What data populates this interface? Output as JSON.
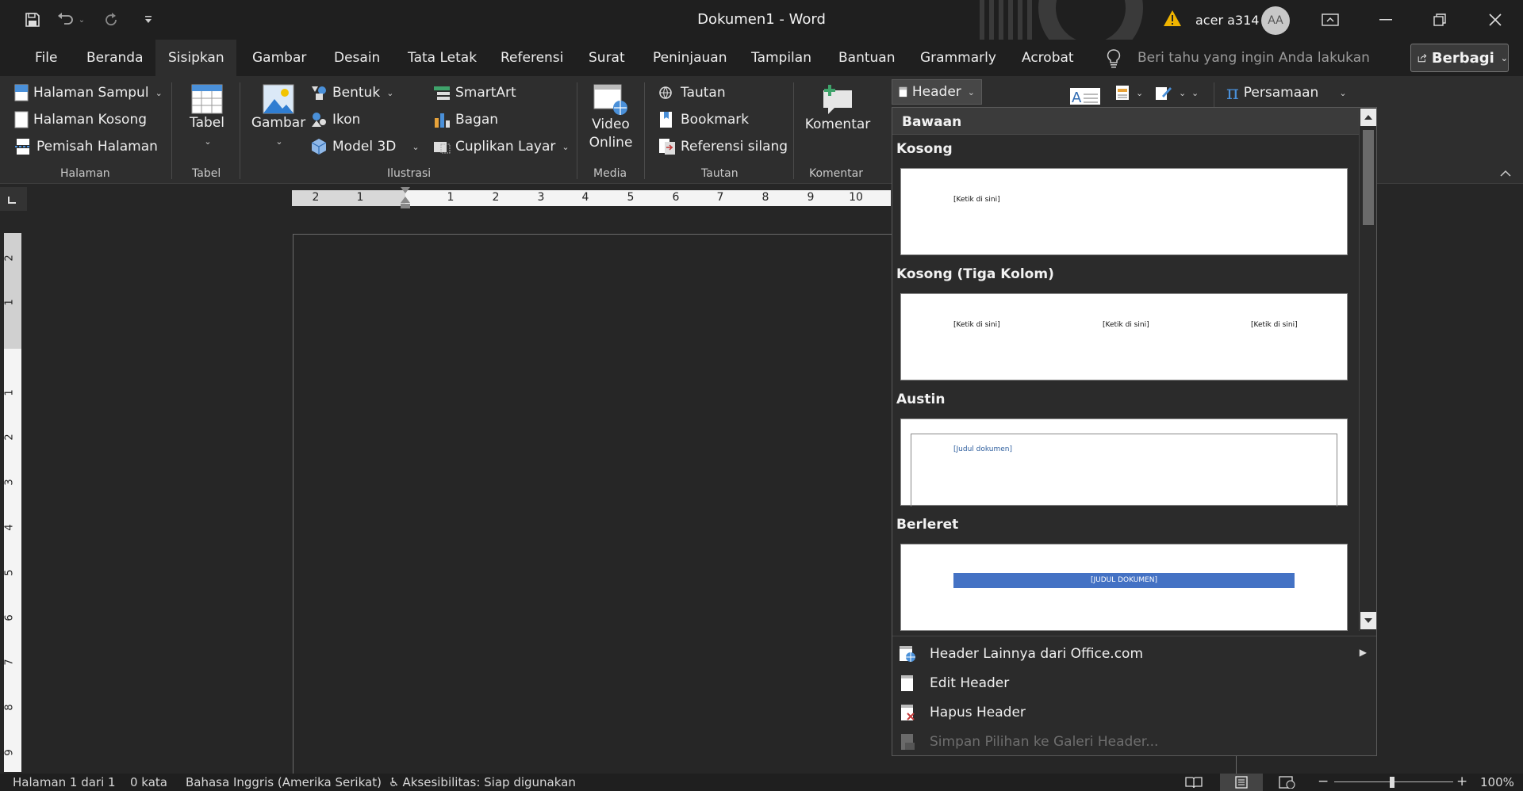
{
  "titlebar": {
    "document_title": "Dokumen1  -  Word",
    "user_name": "acer a314",
    "avatar_initials": "AA"
  },
  "tabs": [
    "File",
    "Beranda",
    "Sisipkan",
    "Gambar",
    "Desain",
    "Tata Letak",
    "Referensi",
    "Surat",
    "Peninjauan",
    "Tampilan",
    "Bantuan",
    "Grammarly",
    "Acrobat"
  ],
  "active_tab": "Sisipkan",
  "tell_me_placeholder": "Beri tahu yang ingin Anda lakukan",
  "share_label": "Berbagi",
  "ribbon": {
    "halaman": {
      "items": [
        "Halaman Sampul",
        "Halaman Kosong",
        "Pemisah Halaman"
      ],
      "group": "Halaman"
    },
    "tabel": {
      "label": "Tabel",
      "group": "Tabel"
    },
    "ilustrasi": {
      "gambar": "Gambar",
      "bentuk": "Bentuk",
      "ikon": "Ikon",
      "model3d": "Model 3D",
      "smartart": "SmartArt",
      "bagan": "Bagan",
      "cuplikan": "Cuplikan Layar",
      "group": "Ilustrasi"
    },
    "media": {
      "label1": "Video",
      "label2": "Online",
      "group": "Media"
    },
    "tautan": {
      "items": [
        "Tautan",
        "Bookmark",
        "Referensi silang"
      ],
      "group": "Tautan"
    },
    "komentar": {
      "label": "Komentar",
      "group": "Komentar"
    },
    "header_button": "Header",
    "persamaan": "Persamaan"
  },
  "ruler": {
    "h_labels": [
      "2",
      "1",
      "1",
      "2",
      "3",
      "4",
      "5",
      "6",
      "7",
      "8",
      "9",
      "10"
    ],
    "v_labels": [
      "2",
      "1",
      "1",
      "2",
      "3",
      "4",
      "5",
      "6",
      "7",
      "8",
      "9"
    ]
  },
  "gallery": {
    "heading": "Bawaan",
    "sections": [
      {
        "name": "Kosong",
        "placeholders": [
          "[Ketik di sini]"
        ]
      },
      {
        "name": "Kosong (Tiga Kolom)",
        "placeholders": [
          "[Ketik di sini]",
          "[Ketik di sini]",
          "[Ketik di sini]"
        ]
      },
      {
        "name": "Austin",
        "placeholders": [
          "[Judul dokumen]"
        ]
      },
      {
        "name": "Berleret",
        "placeholders": [
          "[JUDUL DOKUMEN]"
        ]
      }
    ],
    "menu": [
      {
        "label": "Header Lainnya dari Office.com",
        "enabled": true
      },
      {
        "label": "Edit Header",
        "enabled": true
      },
      {
        "label": "Hapus Header",
        "enabled": true
      },
      {
        "label": "Simpan Pilihan ke Galeri Header...",
        "enabled": false
      }
    ]
  },
  "statusbar": {
    "page": "Halaman 1 dari 1",
    "words": "0 kata",
    "language": "Bahasa Inggris (Amerika Serikat)",
    "accessibility": "Aksesibilitas: Siap digunakan",
    "zoom": "100%"
  },
  "colors": {
    "accent": "#4472c4",
    "warning": "#f0b400",
    "background": "#262626"
  }
}
